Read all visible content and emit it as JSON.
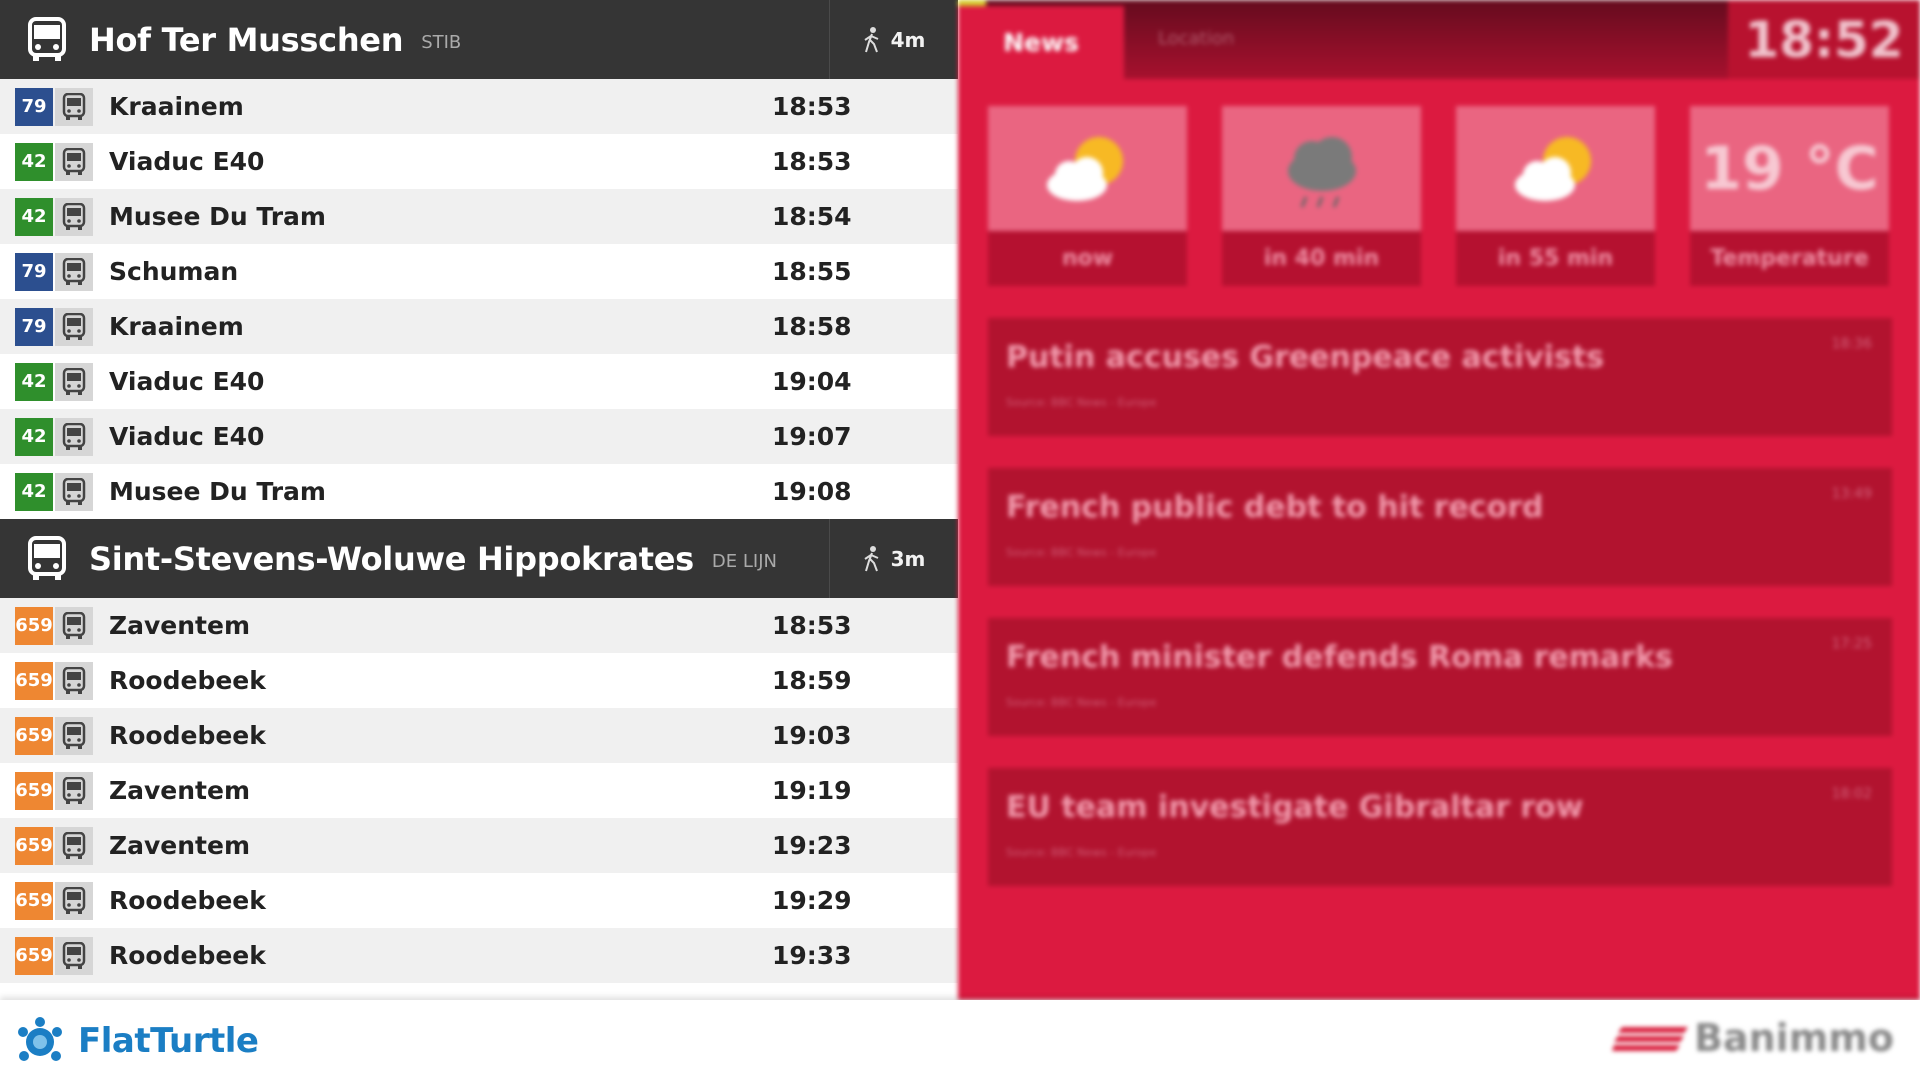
{
  "stations": [
    {
      "name": "Hof Ter Musschen",
      "agency": "STIB",
      "walk_time": "4m",
      "departures": [
        {
          "route": "79",
          "color": "#2c4f8f",
          "destination": "Kraainem",
          "time": "18:53"
        },
        {
          "route": "42",
          "color": "#2f8f2c",
          "destination": "Viaduc E40",
          "time": "18:53"
        },
        {
          "route": "42",
          "color": "#2f8f2c",
          "destination": "Musee Du Tram",
          "time": "18:54"
        },
        {
          "route": "79",
          "color": "#2c4f8f",
          "destination": "Schuman",
          "time": "18:55"
        },
        {
          "route": "79",
          "color": "#2c4f8f",
          "destination": "Kraainem",
          "time": "18:58"
        },
        {
          "route": "42",
          "color": "#2f8f2c",
          "destination": "Viaduc E40",
          "time": "19:04"
        },
        {
          "route": "42",
          "color": "#2f8f2c",
          "destination": "Viaduc E40",
          "time": "19:07"
        },
        {
          "route": "42",
          "color": "#2f8f2c",
          "destination": "Musee Du Tram",
          "time": "19:08"
        }
      ]
    },
    {
      "name": "Sint-Stevens-Woluwe Hippokrates",
      "agency": "DE LIJN",
      "walk_time": "3m",
      "departures": [
        {
          "route": "659",
          "color": "#ee8732",
          "destination": "Zaventem",
          "time": "18:53"
        },
        {
          "route": "659",
          "color": "#ee8732",
          "destination": "Roodebeek",
          "time": "18:59"
        },
        {
          "route": "659",
          "color": "#ee8732",
          "destination": "Roodebeek",
          "time": "19:03"
        },
        {
          "route": "659",
          "color": "#ee8732",
          "destination": "Zaventem",
          "time": "19:19"
        },
        {
          "route": "659",
          "color": "#ee8732",
          "destination": "Zaventem",
          "time": "19:23"
        },
        {
          "route": "659",
          "color": "#ee8732",
          "destination": "Roodebeek",
          "time": "19:29"
        },
        {
          "route": "659",
          "color": "#ee8732",
          "destination": "Roodebeek",
          "time": "19:33"
        }
      ]
    }
  ],
  "right_panel": {
    "tabs": {
      "news": "News",
      "location": "Location"
    },
    "clock": "18:52",
    "weather": [
      {
        "icon": "partly-sunny-icon",
        "label": "now"
      },
      {
        "icon": "rain-cloud-icon",
        "label": "in 40 min"
      },
      {
        "icon": "partly-sunny-icon",
        "label": "in 55 min"
      },
      {
        "value": "19 °C",
        "label": "Temperature"
      }
    ],
    "news": [
      {
        "title": "Putin accuses Greenpeace activists",
        "time": "18:36",
        "source": "Source: BBC News - Europe"
      },
      {
        "title": "French public debt to hit record",
        "time": "13:49",
        "source": "Source: BBC News - Europe"
      },
      {
        "title": "French minister defends Roma remarks",
        "time": "17:25",
        "source": "Source: BBC News - Europe"
      },
      {
        "title": "EU team investigate Gibraltar row",
        "time": "18:02",
        "source": "Source: BBC News - Europe"
      }
    ]
  },
  "footer": {
    "brand": "FlatTurtle",
    "partner": "Banimmo"
  },
  "colors": {
    "panel_red": "#dc1a40",
    "header_dark": "#353535",
    "brand_blue": "#1b7ec4"
  }
}
